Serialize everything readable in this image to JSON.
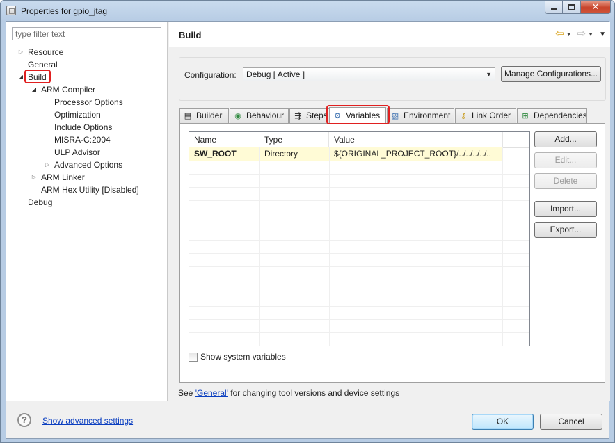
{
  "window": {
    "title": "Properties for gpio_jtag",
    "close_glyph": "✕"
  },
  "filter": {
    "placeholder": "type filter text"
  },
  "tree": {
    "resource": "Resource",
    "general": "General",
    "build": "Build",
    "arm_compiler": "ARM Compiler",
    "processor_options": "Processor Options",
    "optimization": "Optimization",
    "include_options": "Include Options",
    "misra": "MISRA-C:2004",
    "ulp_advisor": "ULP Advisor",
    "advanced_options": "Advanced Options",
    "arm_linker": "ARM Linker",
    "arm_hex_utility": "ARM Hex Utility  [Disabled]",
    "debug": "Debug"
  },
  "page": {
    "title": "Build",
    "config_label": "Configuration:",
    "config_value": "Debug  [ Active ]",
    "manage_label": "Manage Configurations..."
  },
  "tabs": [
    {
      "label": "Builder",
      "icon": "▤"
    },
    {
      "label": "Behaviour",
      "icon": "◉"
    },
    {
      "label": "Steps",
      "icon": "⇶"
    },
    {
      "label": "Variables",
      "icon": "⚙"
    },
    {
      "label": "Environment",
      "icon": "▧"
    },
    {
      "label": "Link Order",
      "icon": "⚷"
    },
    {
      "label": "Dependencies",
      "icon": "⊞"
    }
  ],
  "table": {
    "headers": [
      "Name",
      "Type",
      "Value"
    ],
    "rows": [
      {
        "name": "SW_ROOT",
        "type": "Directory",
        "value": "${ORIGINAL_PROJECT_ROOT}/../../../../.."
      }
    ]
  },
  "buttons": {
    "add": "Add...",
    "edit": "Edit...",
    "delete": "Delete",
    "import": "Import...",
    "export": "Export..."
  },
  "show_system_variables": "Show system variables",
  "footnote": {
    "prefix": "See ",
    "link": "'General'",
    "suffix": " for changing tool versions and device settings"
  },
  "bottom": {
    "help_glyph": "?",
    "advanced_link": "Show advanced settings",
    "ok": "OK",
    "cancel": "Cancel"
  },
  "colors": {
    "highlight_outline": "#e02020",
    "row_highlight": "#fffbd6",
    "link": "#0a3ec0"
  }
}
